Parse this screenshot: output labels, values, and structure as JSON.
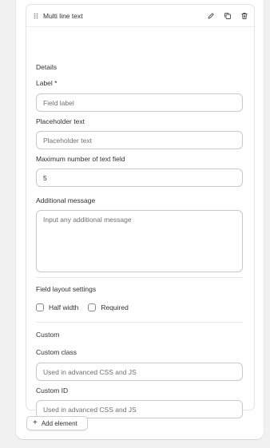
{
  "card": {
    "title": "Multi line text",
    "icons": [
      "drag-handle-icon",
      "edit-icon",
      "duplicate-icon",
      "delete-icon"
    ]
  },
  "details": {
    "heading": "Details",
    "label_label": "Label *",
    "label_placeholder": "Field label",
    "placeholder_label": "Placeholder text",
    "placeholder_placeholder": "Placeholder text",
    "max_label": "Maximum number of text field",
    "max_value": "5",
    "additional_label": "Additional message",
    "additional_placeholder": "Input any additional message"
  },
  "layout_settings": {
    "heading": "Field layout settings",
    "half_width_label": "Half width",
    "required_label": "Required"
  },
  "custom": {
    "heading": "Custom",
    "class_label": "Custom class",
    "class_placeholder": "Used in advanced CSS and JS",
    "id_label": "Custom ID",
    "id_placeholder": "Used in advanced CSS and JS"
  },
  "actions": {
    "add_element_label": "Add element"
  }
}
